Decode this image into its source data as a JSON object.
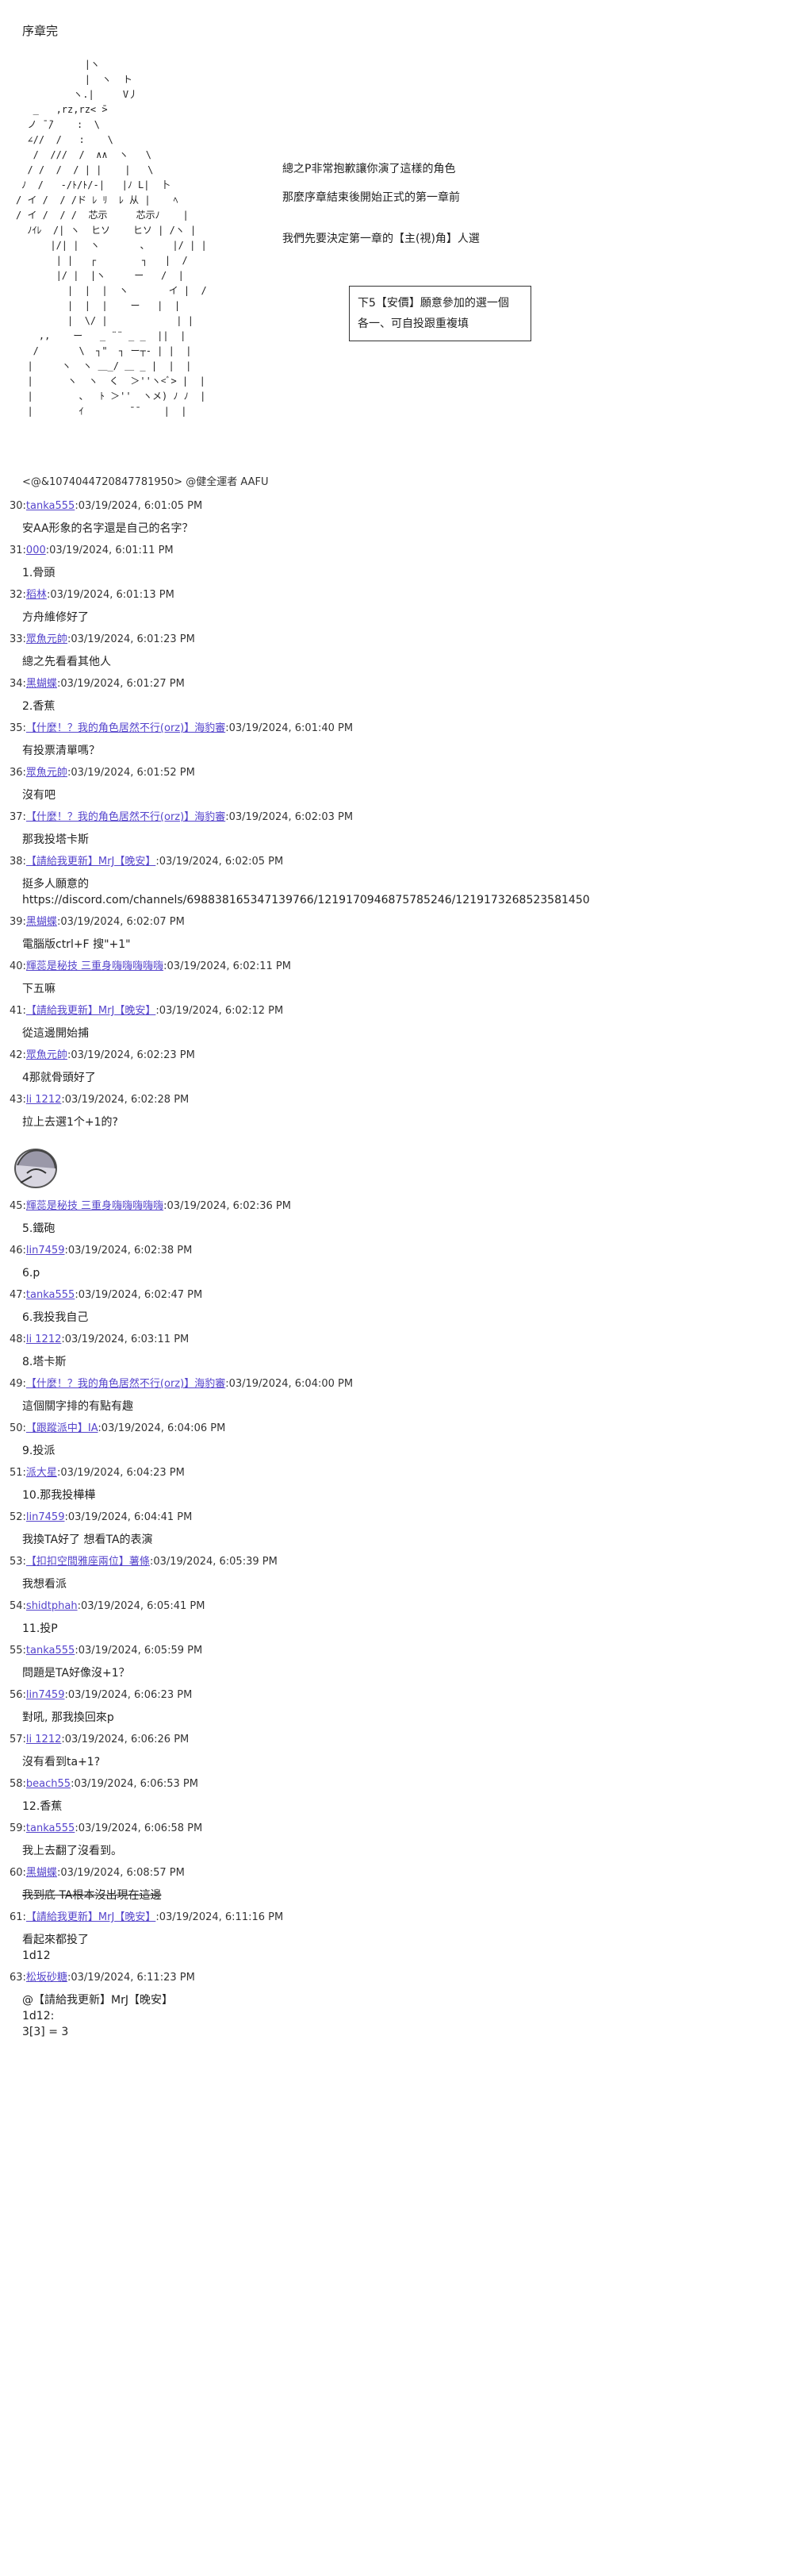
{
  "title": "序章完",
  "ascii_art": "            |ヽ\n            |  ヽ  ト\n          ヽ.|     V丿\n   _   ,rz,rz< ̄>\n  ノ ̄ ̄/    :  \\\n  ∠//  /   :    \\\n   /  ///  /  ∧∧  ヽ   \\\n  / /  /  / | |    |   \\\n ﾉ  /   -/ﾄ/ﾄ/-|   |ﾉ L|  卜\n/ イ /  / /ド ﾚ ﾘ  ﾚ 从 |    ﾍ\n/ イ /  / /  芯示     芯示ﾉ    |\n  ﾉｲﾚ  /| ヽ  ヒソ    ヒソ | /ヽ |\n      |/| |  ヽ       、    |/ | |\n       | |   ┌        ┐   |  /\n       |/ |  |ヽ     ー   /  |\n         |  |  |  ヽ       イ |  /\n         |  |  |    ー   |  |\n         |  \\/ |            | |\n    ,,    ー   _ ¨¨ _ _  ||  |\n   /       \\  ┐\"  ┐ ー┬‐ | |  |\n  |     ヽ  ヽ ＿_/ ＿ _ |  |  |\n  |      ヽ  ヽ  く  ＞''ヽ<ﾞ> |  |\n  |        、  ﾄ ＞''  ヽメ) ﾉ ﾉ  |\n  |        ｲ        ̄ ̄     |  |",
  "narration": [
    "總之P非常抱歉讓你演了這樣的角色",
    "那麼序章結束後開始正式的第一章前",
    "我們先要決定第一章的【主(視)角】人選"
  ],
  "box_lines": [
    "下5【安價】願意參加的選一個",
    "各一、可自投跟重複填"
  ],
  "source_line": "<@&1074044720847781950> @健全運者 AAFU",
  "posts": [
    {
      "num": "30:",
      "user": "tanka555",
      "date": ":03/19/2024, 6:01:05 PM",
      "body": "安AA形象的名字還是自己的名字？"
    },
    {
      "num": "31:",
      "user": "000",
      "date": ":03/19/2024, 6:01:11 PM",
      "body": "1.骨頭"
    },
    {
      "num": "32:",
      "user": "稻林",
      "date": ":03/19/2024, 6:01:13 PM",
      "body": "方舟維修好了"
    },
    {
      "num": "33:",
      "user": "眾魚元帥",
      "date": ":03/19/2024, 6:01:23 PM",
      "body": "總之先看看其他人"
    },
    {
      "num": "34:",
      "user": "黑蝴蝶",
      "date": ":03/19/2024, 6:01:27 PM",
      "body": "2.香蕉"
    },
    {
      "num": "35:",
      "user": "【什麼！？我的角色居然不行(orz)】海豹審",
      "date": ":03/19/2024, 6:01:40 PM",
      "body": "有投票清單嗎？"
    },
    {
      "num": "36:",
      "user": "眾魚元帥",
      "date": ":03/19/2024, 6:01:52 PM",
      "body": "沒有吧"
    },
    {
      "num": "37:",
      "user": "【什麼！？我的角色居然不行(orz)】海豹審",
      "date": ":03/19/2024, 6:02:03 PM",
      "body": "那我投塔卡斯"
    },
    {
      "num": "38:",
      "user": "【請給我更新】MrJ【晚安】",
      "date": ":03/19/2024, 6:02:05 PM",
      "body": "挺多人願意的\nhttps://discord.com/channels/698838165347139766/1219170946875785246/1219173268523581450"
    },
    {
      "num": "39:",
      "user": "黑蝴蝶",
      "date": ":03/19/2024, 6:02:07 PM",
      "body": "電腦版ctrl+F 搜\"+1\""
    },
    {
      "num": "40:",
      "user": "輝蕊是秘技 三重身嗨嗨嗨嗨嗨",
      "date": ":03/19/2024, 6:02:11 PM",
      "body": "下五嘛"
    },
    {
      "num": "41:",
      "user": "【請給我更新】MrJ【晚安】",
      "date": ":03/19/2024, 6:02:12 PM",
      "body": "從這邊開始捕"
    },
    {
      "num": "42:",
      "user": "眾魚元帥",
      "date": ":03/19/2024, 6:02:23 PM",
      "body": "4那就骨頭好了"
    },
    {
      "num": "43:",
      "user": "li 1212",
      "date": ":03/19/2024, 6:02:28 PM",
      "body": "拉上去選1个+1的?"
    },
    {
      "num": "",
      "user": "",
      "date": "",
      "body": "",
      "avatar": true
    },
    {
      "num": "45:",
      "user": "輝蕊是秘技 三重身嗨嗨嗨嗨嗨",
      "date": ":03/19/2024, 6:02:36 PM",
      "body": "5.鐵砲"
    },
    {
      "num": "46:",
      "user": "lin7459",
      "date": ":03/19/2024, 6:02:38 PM",
      "body": "6.p"
    },
    {
      "num": "47:",
      "user": "tanka555",
      "date": ":03/19/2024, 6:02:47 PM",
      "body": "6.我投我自己"
    },
    {
      "num": "48:",
      "user": "li 1212",
      "date": ":03/19/2024, 6:03:11 PM",
      "body": "8.塔卡斯"
    },
    {
      "num": "49:",
      "user": "【什麼！？我的角色居然不行(orz)】海豹審",
      "date": ":03/19/2024, 6:04:00 PM",
      "body": "這個關字排的有點有趣"
    },
    {
      "num": "50:",
      "user": "【跟蹤派中】IA",
      "date": ":03/19/2024, 6:04:06 PM",
      "body": "9.投派"
    },
    {
      "num": "51:",
      "user": "派大星",
      "date": ":03/19/2024, 6:04:23 PM",
      "body": "10.那我投樺樺"
    },
    {
      "num": "52:",
      "user": "lin7459",
      "date": ":03/19/2024, 6:04:41 PM",
      "body": "我換TA好了 想看TA的表演"
    },
    {
      "num": "53:",
      "user": "【扣扣空間雅座兩位】薯條",
      "date": ":03/19/2024, 6:05:39 PM",
      "body": "我想看派"
    },
    {
      "num": "54:",
      "user": "shidtphah",
      "date": ":03/19/2024, 6:05:41 PM",
      "body": "11.投P"
    },
    {
      "num": "55:",
      "user": "tanka555",
      "date": ":03/19/2024, 6:05:59 PM",
      "body": "問題是TA好像沒+1？"
    },
    {
      "num": "56:",
      "user": "lin7459",
      "date": ":03/19/2024, 6:06:23 PM",
      "body": "對吼, 那我換回來p"
    },
    {
      "num": "57:",
      "user": "li 1212",
      "date": ":03/19/2024, 6:06:26 PM",
      "body": "沒有看到ta+1?"
    },
    {
      "num": "58:",
      "user": "beach55",
      "date": ":03/19/2024, 6:06:53 PM",
      "body": "12.香蕉"
    },
    {
      "num": "59:",
      "user": "tanka555",
      "date": ":03/19/2024, 6:06:58 PM",
      "body": "我上去翻了沒看到。"
    },
    {
      "num": "60:",
      "user": "黑蝴蝶",
      "date": ":03/19/2024, 6:08:57 PM",
      "body": "我到底 TA根本沒出現在這邊",
      "strike": true
    },
    {
      "num": "61:",
      "user": "【請給我更新】MrJ【晚安】",
      "date": ":03/19/2024, 6:11:16 PM",
      "body": "看起來都投了\n1d12"
    },
    {
      "num": "63:",
      "user": "松坂砂糖",
      "date": ":03/19/2024, 6:11:23 PM",
      "body": "@【請給我更新】MrJ【晚安】\n1d12:\n3[3] = 3"
    }
  ]
}
